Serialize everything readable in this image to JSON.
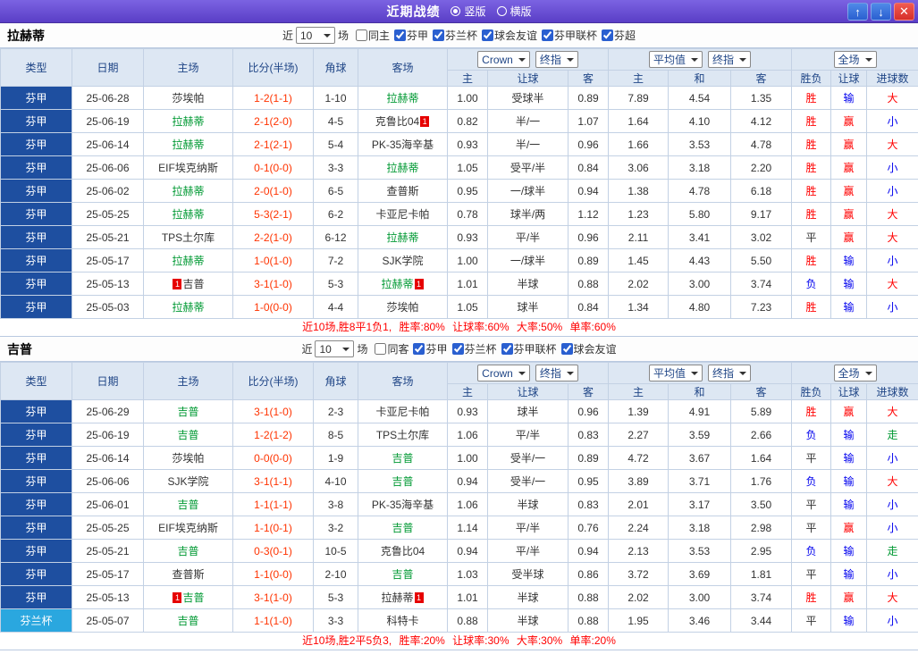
{
  "topbar": {
    "title": "近期战绩",
    "radios": [
      {
        "label": "竖版",
        "selected": true
      },
      {
        "label": "横版",
        "selected": false
      }
    ],
    "buttons": {
      "up": "↑",
      "down": "↓",
      "close": "✕"
    }
  },
  "filter": {
    "pre_label": "近",
    "post_label": "场"
  },
  "table": {
    "selects": {
      "book": "Crown",
      "final": "终指",
      "avg": "平均值",
      "full": "全场"
    },
    "h1": [
      "类型",
      "日期",
      "主场",
      "比分(半场)",
      "角球",
      "客场"
    ],
    "h2": [
      "主",
      "让球",
      "客",
      "主",
      "和",
      "客",
      "胜负",
      "让球",
      "进球数"
    ]
  },
  "colors": {
    "league": {
      "芬甲": "#1e4fa0",
      "芬兰杯": "#2aa7df"
    },
    "values": {
      "胜": "#ff0000",
      "平": "#333333",
      "负": "#0000ee",
      "赢": "#ff0000",
      "输": "#0000ee",
      "大": "#ff0000",
      "小": "#0000ee",
      "走": "#009933"
    },
    "score": "#ff3300",
    "team_highlight": "#009933",
    "summary_text": "#ff0000"
  },
  "badge_char": "1",
  "sections": [
    {
      "team": "拉赫蒂",
      "recent_count": "10",
      "filters": [
        {
          "label": "同主",
          "checked": false
        },
        {
          "label": "芬甲",
          "checked": true
        },
        {
          "label": "芬兰杯",
          "checked": true
        },
        {
          "label": "球会友谊",
          "checked": true
        },
        {
          "label": "芬甲联杯",
          "checked": true
        },
        {
          "label": "芬超",
          "checked": true
        }
      ],
      "rows": [
        {
          "league": "芬甲",
          "date": "25-06-28",
          "home": "莎埃帕",
          "home_hl": false,
          "home_badge": null,
          "score": "1-2(1-1)",
          "corners": "1-10",
          "away": "拉赫蒂",
          "away_hl": true,
          "away_badge": null,
          "odds": [
            "1.00",
            "受球半",
            "0.89"
          ],
          "avg": [
            "7.89",
            "4.54",
            "1.35"
          ],
          "results": [
            "胜",
            "输",
            "大"
          ]
        },
        {
          "league": "芬甲",
          "date": "25-06-19",
          "home": "拉赫蒂",
          "home_hl": true,
          "home_badge": null,
          "score": "2-1(2-0)",
          "corners": "4-5",
          "away": "克鲁比04",
          "away_hl": false,
          "away_badge": "post",
          "odds": [
            "0.82",
            "半/一",
            "1.07"
          ],
          "avg": [
            "1.64",
            "4.10",
            "4.12"
          ],
          "results": [
            "胜",
            "赢",
            "小"
          ]
        },
        {
          "league": "芬甲",
          "date": "25-06-14",
          "home": "拉赫蒂",
          "home_hl": true,
          "home_badge": null,
          "score": "2-1(2-1)",
          "corners": "5-4",
          "away": "PK-35海辛基",
          "away_hl": false,
          "away_badge": null,
          "odds": [
            "0.93",
            "半/一",
            "0.96"
          ],
          "avg": [
            "1.66",
            "3.53",
            "4.78"
          ],
          "results": [
            "胜",
            "赢",
            "大"
          ]
        },
        {
          "league": "芬甲",
          "date": "25-06-06",
          "home": "EIF埃克纳斯",
          "home_hl": false,
          "home_badge": null,
          "score": "0-1(0-0)",
          "corners": "3-3",
          "away": "拉赫蒂",
          "away_hl": true,
          "away_badge": null,
          "odds": [
            "1.05",
            "受平/半",
            "0.84"
          ],
          "avg": [
            "3.06",
            "3.18",
            "2.20"
          ],
          "results": [
            "胜",
            "赢",
            "小"
          ]
        },
        {
          "league": "芬甲",
          "date": "25-06-02",
          "home": "拉赫蒂",
          "home_hl": true,
          "home_badge": null,
          "score": "2-0(1-0)",
          "corners": "6-5",
          "away": "查普斯",
          "away_hl": false,
          "away_badge": null,
          "odds": [
            "0.95",
            "一/球半",
            "0.94"
          ],
          "avg": [
            "1.38",
            "4.78",
            "6.18"
          ],
          "results": [
            "胜",
            "赢",
            "小"
          ]
        },
        {
          "league": "芬甲",
          "date": "25-05-25",
          "home": "拉赫蒂",
          "home_hl": true,
          "home_badge": null,
          "score": "5-3(2-1)",
          "corners": "6-2",
          "away": "卡亚尼卡帕",
          "away_hl": false,
          "away_badge": null,
          "odds": [
            "0.78",
            "球半/两",
            "1.12"
          ],
          "avg": [
            "1.23",
            "5.80",
            "9.17"
          ],
          "results": [
            "胜",
            "赢",
            "大"
          ]
        },
        {
          "league": "芬甲",
          "date": "25-05-21",
          "home": "TPS土尔库",
          "home_hl": false,
          "home_badge": null,
          "score": "2-2(1-0)",
          "corners": "6-12",
          "away": "拉赫蒂",
          "away_hl": true,
          "away_badge": null,
          "odds": [
            "0.93",
            "平/半",
            "0.96"
          ],
          "avg": [
            "2.11",
            "3.41",
            "3.02"
          ],
          "results": [
            "平",
            "赢",
            "大"
          ]
        },
        {
          "league": "芬甲",
          "date": "25-05-17",
          "home": "拉赫蒂",
          "home_hl": true,
          "home_badge": null,
          "score": "1-0(1-0)",
          "corners": "7-2",
          "away": "SJK学院",
          "away_hl": false,
          "away_badge": null,
          "odds": [
            "1.00",
            "一/球半",
            "0.89"
          ],
          "avg": [
            "1.45",
            "4.43",
            "5.50"
          ],
          "results": [
            "胜",
            "输",
            "小"
          ]
        },
        {
          "league": "芬甲",
          "date": "25-05-13",
          "home": "吉普",
          "home_hl": false,
          "home_badge": "pre",
          "score": "3-1(1-0)",
          "corners": "5-3",
          "away": "拉赫蒂",
          "away_hl": true,
          "away_badge": "post",
          "odds": [
            "1.01",
            "半球",
            "0.88"
          ],
          "avg": [
            "2.02",
            "3.00",
            "3.74"
          ],
          "results": [
            "负",
            "输",
            "大"
          ]
        },
        {
          "league": "芬甲",
          "date": "25-05-03",
          "home": "拉赫蒂",
          "home_hl": true,
          "home_badge": null,
          "score": "1-0(0-0)",
          "corners": "4-4",
          "away": "莎埃帕",
          "away_hl": false,
          "away_badge": null,
          "odds": [
            "1.05",
            "球半",
            "0.84"
          ],
          "avg": [
            "1.34",
            "4.80",
            "7.23"
          ],
          "results": [
            "胜",
            "输",
            "小"
          ]
        }
      ],
      "summary": "近10场,胜8平1负1, 胜率:80% 让球率:60% 大率:50% 单率:60%"
    },
    {
      "team": "吉普",
      "recent_count": "10",
      "filters": [
        {
          "label": "同客",
          "checked": false
        },
        {
          "label": "芬甲",
          "checked": true
        },
        {
          "label": "芬兰杯",
          "checked": true
        },
        {
          "label": "芬甲联杯",
          "checked": true
        },
        {
          "label": "球会友谊",
          "checked": true
        }
      ],
      "rows": [
        {
          "league": "芬甲",
          "date": "25-06-29",
          "home": "吉普",
          "home_hl": true,
          "home_badge": null,
          "score": "3-1(1-0)",
          "corners": "2-3",
          "away": "卡亚尼卡帕",
          "away_hl": false,
          "away_badge": null,
          "odds": [
            "0.93",
            "球半",
            "0.96"
          ],
          "avg": [
            "1.39",
            "4.91",
            "5.89"
          ],
          "results": [
            "胜",
            "赢",
            "大"
          ]
        },
        {
          "league": "芬甲",
          "date": "25-06-19",
          "home": "吉普",
          "home_hl": true,
          "home_badge": null,
          "score": "1-2(1-2)",
          "corners": "8-5",
          "away": "TPS土尔库",
          "away_hl": false,
          "away_badge": null,
          "odds": [
            "1.06",
            "平/半",
            "0.83"
          ],
          "avg": [
            "2.27",
            "3.59",
            "2.66"
          ],
          "results": [
            "负",
            "输",
            "走"
          ]
        },
        {
          "league": "芬甲",
          "date": "25-06-14",
          "home": "莎埃帕",
          "home_hl": false,
          "home_badge": null,
          "score": "0-0(0-0)",
          "corners": "1-9",
          "away": "吉普",
          "away_hl": true,
          "away_badge": null,
          "odds": [
            "1.00",
            "受半/一",
            "0.89"
          ],
          "avg": [
            "4.72",
            "3.67",
            "1.64"
          ],
          "results": [
            "平",
            "输",
            "小"
          ]
        },
        {
          "league": "芬甲",
          "date": "25-06-06",
          "home": "SJK学院",
          "home_hl": false,
          "home_badge": null,
          "score": "3-1(1-1)",
          "corners": "4-10",
          "away": "吉普",
          "away_hl": true,
          "away_badge": null,
          "odds": [
            "0.94",
            "受半/一",
            "0.95"
          ],
          "avg": [
            "3.89",
            "3.71",
            "1.76"
          ],
          "results": [
            "负",
            "输",
            "大"
          ]
        },
        {
          "league": "芬甲",
          "date": "25-06-01",
          "home": "吉普",
          "home_hl": true,
          "home_badge": null,
          "score": "1-1(1-1)",
          "corners": "3-8",
          "away": "PK-35海辛基",
          "away_hl": false,
          "away_badge": null,
          "odds": [
            "1.06",
            "半球",
            "0.83"
          ],
          "avg": [
            "2.01",
            "3.17",
            "3.50"
          ],
          "results": [
            "平",
            "输",
            "小"
          ]
        },
        {
          "league": "芬甲",
          "date": "25-05-25",
          "home": "EIF埃克纳斯",
          "home_hl": false,
          "home_badge": null,
          "score": "1-1(0-1)",
          "corners": "3-2",
          "away": "吉普",
          "away_hl": true,
          "away_badge": null,
          "odds": [
            "1.14",
            "平/半",
            "0.76"
          ],
          "avg": [
            "2.24",
            "3.18",
            "2.98"
          ],
          "results": [
            "平",
            "赢",
            "小"
          ]
        },
        {
          "league": "芬甲",
          "date": "25-05-21",
          "home": "吉普",
          "home_hl": true,
          "home_badge": null,
          "score": "0-3(0-1)",
          "corners": "10-5",
          "away": "克鲁比04",
          "away_hl": false,
          "away_badge": null,
          "odds": [
            "0.94",
            "平/半",
            "0.94"
          ],
          "avg": [
            "2.13",
            "3.53",
            "2.95"
          ],
          "results": [
            "负",
            "输",
            "走"
          ]
        },
        {
          "league": "芬甲",
          "date": "25-05-17",
          "home": "查普斯",
          "home_hl": false,
          "home_badge": null,
          "score": "1-1(0-0)",
          "corners": "2-10",
          "away": "吉普",
          "away_hl": true,
          "away_badge": null,
          "odds": [
            "1.03",
            "受半球",
            "0.86"
          ],
          "avg": [
            "3.72",
            "3.69",
            "1.81"
          ],
          "results": [
            "平",
            "输",
            "小"
          ]
        },
        {
          "league": "芬甲",
          "date": "25-05-13",
          "home": "吉普",
          "home_hl": true,
          "home_badge": "pre",
          "score": "3-1(1-0)",
          "corners": "5-3",
          "away": "拉赫蒂",
          "away_hl": false,
          "away_badge": "post",
          "odds": [
            "1.01",
            "半球",
            "0.88"
          ],
          "avg": [
            "2.02",
            "3.00",
            "3.74"
          ],
          "results": [
            "胜",
            "赢",
            "大"
          ]
        },
        {
          "league": "芬兰杯",
          "date": "25-05-07",
          "home": "吉普",
          "home_hl": true,
          "home_badge": null,
          "score": "1-1(1-0)",
          "corners": "3-3",
          "away": "科特卡",
          "away_hl": false,
          "away_badge": null,
          "odds": [
            "0.88",
            "半球",
            "0.88"
          ],
          "avg": [
            "1.95",
            "3.46",
            "3.44"
          ],
          "results": [
            "平",
            "输",
            "小"
          ]
        }
      ],
      "summary": "近10场,胜2平5负3, 胜率:20% 让球率:30% 大率:30% 单率:20%"
    }
  ]
}
